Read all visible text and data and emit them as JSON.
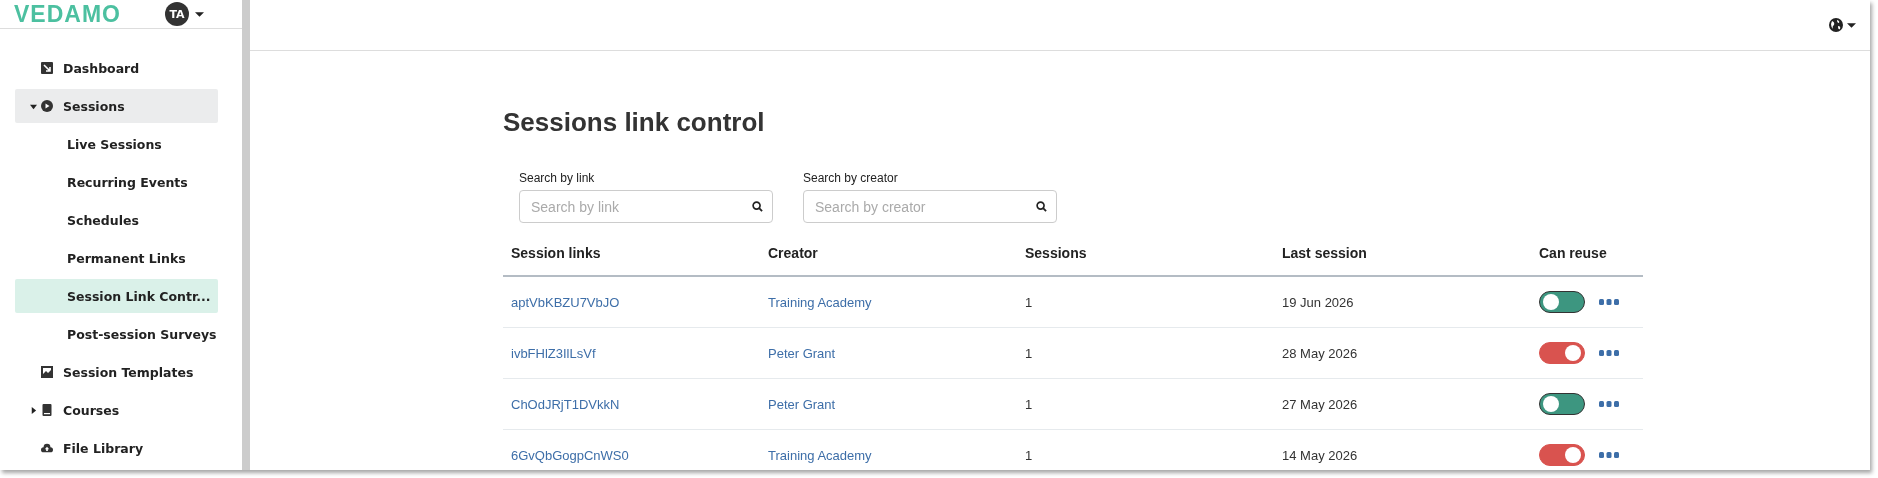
{
  "sidebar": {
    "logo": "VEDAMO",
    "avatar": "TA",
    "items": [
      {
        "label": "Dashboard",
        "selected": false
      },
      {
        "label": "Sessions",
        "selected": false,
        "expanded": true,
        "children": [
          {
            "label": "Live Sessions",
            "selected": false
          },
          {
            "label": "Recurring Events",
            "selected": false
          },
          {
            "label": "Schedules",
            "selected": false
          },
          {
            "label": "Permanent Links",
            "selected": false
          },
          {
            "label": "Session Link Contr...",
            "selected": true
          },
          {
            "label": "Post-session Surveys",
            "selected": false
          }
        ]
      },
      {
        "label": "Session Templates",
        "selected": false
      },
      {
        "label": "Courses",
        "selected": false,
        "expanded": false
      },
      {
        "label": "File Library",
        "selected": false
      }
    ]
  },
  "page": {
    "title": "Sessions link control",
    "filters": [
      {
        "label": "Search by link",
        "placeholder": "Search by link"
      },
      {
        "label": "Search by creator",
        "placeholder": "Search by creator"
      }
    ],
    "table": {
      "columns": [
        "Session links",
        "Creator",
        "Sessions",
        "Last session",
        "Can reuse"
      ],
      "rows": [
        {
          "link": "aptVbKBZU7VbJO",
          "creator": "Training Academy",
          "sessions": "1",
          "last_session": "19 Jun 2026",
          "can_reuse": false
        },
        {
          "link": "ivbFHlZ3IlLsVf",
          "creator": "Peter Grant",
          "sessions": "1",
          "last_session": "28 May 2026",
          "can_reuse": true
        },
        {
          "link": "ChOdJRjT1DVkkN",
          "creator": "Peter Grant",
          "sessions": "1",
          "last_session": "27 May 2026",
          "can_reuse": false
        },
        {
          "link": "6GvQbGogpCnWS0",
          "creator": "Training Academy",
          "sessions": "1",
          "last_session": "14 May 2026",
          "can_reuse": true
        }
      ]
    }
  }
}
